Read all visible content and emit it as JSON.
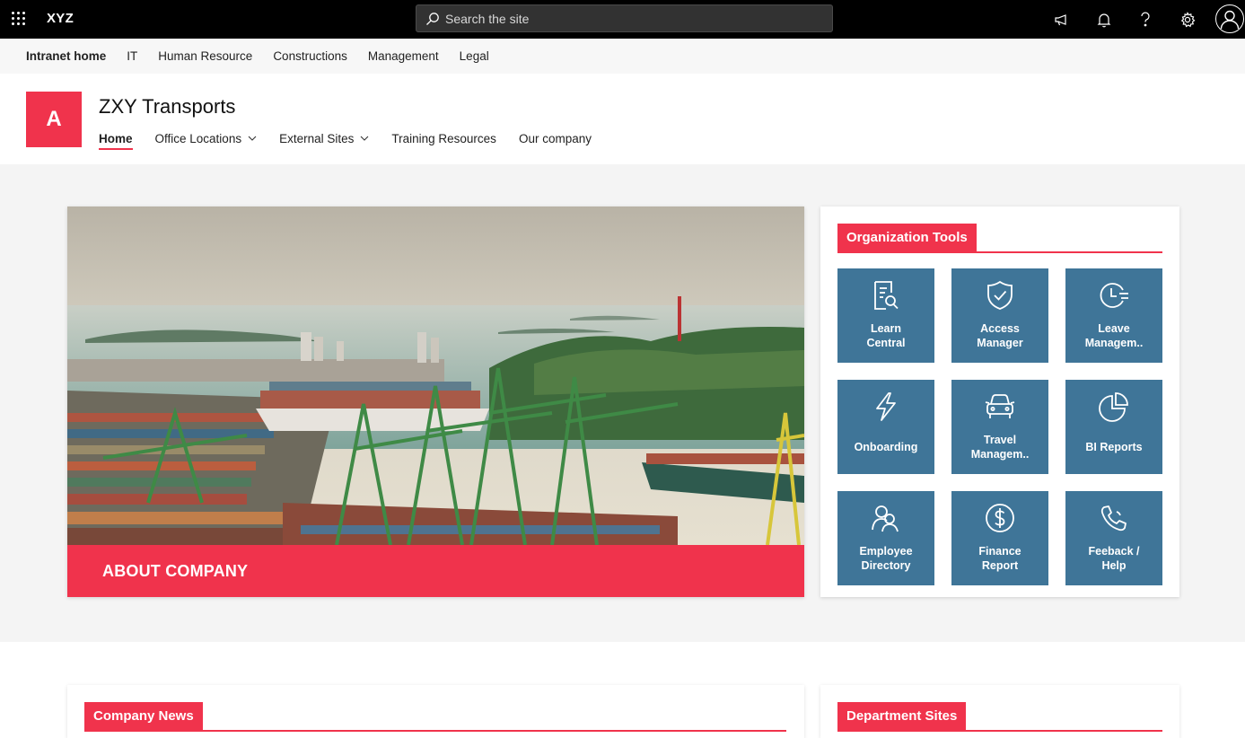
{
  "suite": {
    "brand": "XYZ",
    "search_placeholder": "Search the site",
    "icons": [
      "waffle-icon",
      "megaphone-icon",
      "bell-icon",
      "help-icon",
      "gear-icon",
      "user-avatar-icon"
    ]
  },
  "hub_nav": {
    "items": [
      "Intranet home",
      "IT",
      "Human Resource",
      "Constructions",
      "Management",
      "Legal"
    ]
  },
  "site": {
    "logo_letter": "A",
    "title": "ZXY Transports",
    "nav": [
      {
        "label": "Home",
        "active": true,
        "dropdown": false
      },
      {
        "label": "Office Locations",
        "active": false,
        "dropdown": true
      },
      {
        "label": "External Sites",
        "active": false,
        "dropdown": true
      },
      {
        "label": "Training Resources",
        "active": false,
        "dropdown": false
      },
      {
        "label": "Our company",
        "active": false,
        "dropdown": false
      }
    ]
  },
  "hero": {
    "band_label": "ABOUT COMPANY",
    "image_icon": "harbor-photo"
  },
  "org_tools": {
    "title": "Organization Tools",
    "tiles": [
      {
        "label": "Learn Central",
        "line1": "Learn",
        "line2": "Central",
        "icon": "document-search-icon"
      },
      {
        "label": "Access Manager",
        "line1": "Access",
        "line2": "Manager",
        "icon": "shield-check-icon"
      },
      {
        "label": "Leave Managem..",
        "line1": "Leave",
        "line2": "Managem..",
        "icon": "clock-icon"
      },
      {
        "label": "Onboarding",
        "line1": "Onboarding",
        "line2": "",
        "icon": "lightning-icon"
      },
      {
        "label": "Travel Managem..",
        "line1": "Travel",
        "line2": "Managem..",
        "icon": "car-icon"
      },
      {
        "label": "BI Reports",
        "line1": "BI Reports",
        "line2": "",
        "icon": "pie-chart-icon"
      },
      {
        "label": "Employee Directory",
        "line1": "Employee",
        "line2": "Directory",
        "icon": "people-icon"
      },
      {
        "label": "Finance Report",
        "line1": "Finance",
        "line2": "Report",
        "icon": "dollar-icon"
      },
      {
        "label": "Feeback / Help",
        "line1": "Feeback /",
        "line2": "Help",
        "icon": "phone-icon"
      }
    ]
  },
  "company_news": {
    "title": "Company News"
  },
  "department_sites": {
    "title": "Department Sites"
  },
  "colors": {
    "accent": "#f0334c",
    "tile": "#3f7598",
    "suite": "#000000"
  }
}
